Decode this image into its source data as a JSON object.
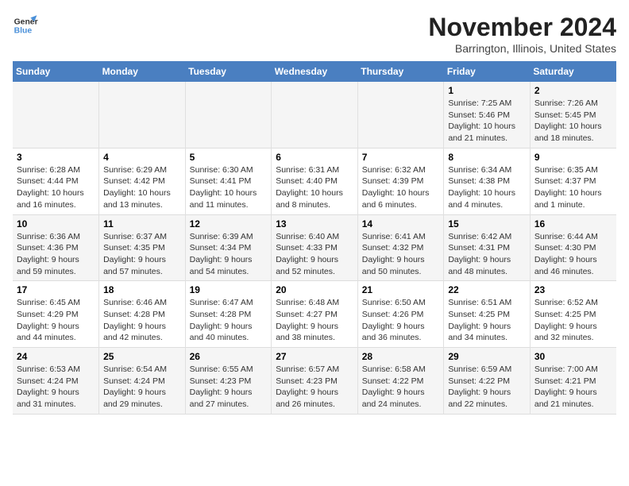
{
  "logo": {
    "line1": "General",
    "line2": "Blue"
  },
  "title": "November 2024",
  "location": "Barrington, Illinois, United States",
  "weekdays": [
    "Sunday",
    "Monday",
    "Tuesday",
    "Wednesday",
    "Thursday",
    "Friday",
    "Saturday"
  ],
  "weeks": [
    [
      {
        "day": "",
        "info": ""
      },
      {
        "day": "",
        "info": ""
      },
      {
        "day": "",
        "info": ""
      },
      {
        "day": "",
        "info": ""
      },
      {
        "day": "",
        "info": ""
      },
      {
        "day": "1",
        "info": "Sunrise: 7:25 AM\nSunset: 5:46 PM\nDaylight: 10 hours and 21 minutes."
      },
      {
        "day": "2",
        "info": "Sunrise: 7:26 AM\nSunset: 5:45 PM\nDaylight: 10 hours and 18 minutes."
      }
    ],
    [
      {
        "day": "3",
        "info": "Sunrise: 6:28 AM\nSunset: 4:44 PM\nDaylight: 10 hours and 16 minutes."
      },
      {
        "day": "4",
        "info": "Sunrise: 6:29 AM\nSunset: 4:42 PM\nDaylight: 10 hours and 13 minutes."
      },
      {
        "day": "5",
        "info": "Sunrise: 6:30 AM\nSunset: 4:41 PM\nDaylight: 10 hours and 11 minutes."
      },
      {
        "day": "6",
        "info": "Sunrise: 6:31 AM\nSunset: 4:40 PM\nDaylight: 10 hours and 8 minutes."
      },
      {
        "day": "7",
        "info": "Sunrise: 6:32 AM\nSunset: 4:39 PM\nDaylight: 10 hours and 6 minutes."
      },
      {
        "day": "8",
        "info": "Sunrise: 6:34 AM\nSunset: 4:38 PM\nDaylight: 10 hours and 4 minutes."
      },
      {
        "day": "9",
        "info": "Sunrise: 6:35 AM\nSunset: 4:37 PM\nDaylight: 10 hours and 1 minute."
      }
    ],
    [
      {
        "day": "10",
        "info": "Sunrise: 6:36 AM\nSunset: 4:36 PM\nDaylight: 9 hours and 59 minutes."
      },
      {
        "day": "11",
        "info": "Sunrise: 6:37 AM\nSunset: 4:35 PM\nDaylight: 9 hours and 57 minutes."
      },
      {
        "day": "12",
        "info": "Sunrise: 6:39 AM\nSunset: 4:34 PM\nDaylight: 9 hours and 54 minutes."
      },
      {
        "day": "13",
        "info": "Sunrise: 6:40 AM\nSunset: 4:33 PM\nDaylight: 9 hours and 52 minutes."
      },
      {
        "day": "14",
        "info": "Sunrise: 6:41 AM\nSunset: 4:32 PM\nDaylight: 9 hours and 50 minutes."
      },
      {
        "day": "15",
        "info": "Sunrise: 6:42 AM\nSunset: 4:31 PM\nDaylight: 9 hours and 48 minutes."
      },
      {
        "day": "16",
        "info": "Sunrise: 6:44 AM\nSunset: 4:30 PM\nDaylight: 9 hours and 46 minutes."
      }
    ],
    [
      {
        "day": "17",
        "info": "Sunrise: 6:45 AM\nSunset: 4:29 PM\nDaylight: 9 hours and 44 minutes."
      },
      {
        "day": "18",
        "info": "Sunrise: 6:46 AM\nSunset: 4:28 PM\nDaylight: 9 hours and 42 minutes."
      },
      {
        "day": "19",
        "info": "Sunrise: 6:47 AM\nSunset: 4:28 PM\nDaylight: 9 hours and 40 minutes."
      },
      {
        "day": "20",
        "info": "Sunrise: 6:48 AM\nSunset: 4:27 PM\nDaylight: 9 hours and 38 minutes."
      },
      {
        "day": "21",
        "info": "Sunrise: 6:50 AM\nSunset: 4:26 PM\nDaylight: 9 hours and 36 minutes."
      },
      {
        "day": "22",
        "info": "Sunrise: 6:51 AM\nSunset: 4:25 PM\nDaylight: 9 hours and 34 minutes."
      },
      {
        "day": "23",
        "info": "Sunrise: 6:52 AM\nSunset: 4:25 PM\nDaylight: 9 hours and 32 minutes."
      }
    ],
    [
      {
        "day": "24",
        "info": "Sunrise: 6:53 AM\nSunset: 4:24 PM\nDaylight: 9 hours and 31 minutes."
      },
      {
        "day": "25",
        "info": "Sunrise: 6:54 AM\nSunset: 4:24 PM\nDaylight: 9 hours and 29 minutes."
      },
      {
        "day": "26",
        "info": "Sunrise: 6:55 AM\nSunset: 4:23 PM\nDaylight: 9 hours and 27 minutes."
      },
      {
        "day": "27",
        "info": "Sunrise: 6:57 AM\nSunset: 4:23 PM\nDaylight: 9 hours and 26 minutes."
      },
      {
        "day": "28",
        "info": "Sunrise: 6:58 AM\nSunset: 4:22 PM\nDaylight: 9 hours and 24 minutes."
      },
      {
        "day": "29",
        "info": "Sunrise: 6:59 AM\nSunset: 4:22 PM\nDaylight: 9 hours and 22 minutes."
      },
      {
        "day": "30",
        "info": "Sunrise: 7:00 AM\nSunset: 4:21 PM\nDaylight: 9 hours and 21 minutes."
      }
    ]
  ]
}
